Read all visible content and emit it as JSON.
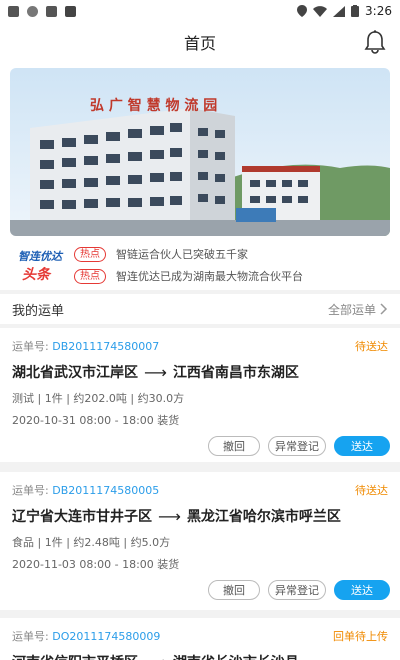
{
  "statusbar": {
    "time": "3:26"
  },
  "header": {
    "title": "首页"
  },
  "news": {
    "logo_line1": "智连优达",
    "logo_line2": "头条",
    "items": [
      {
        "tag": "热点",
        "text": "智链运合伙人已突破五千家"
      },
      {
        "tag": "热点",
        "text": "智连优达已成为湖南最大物流合伙平台"
      }
    ]
  },
  "banner": {
    "sign_text": "弘 广 智 慧 物 流 园"
  },
  "section": {
    "title": "我的运单",
    "all_label": "全部运单"
  },
  "orders": [
    {
      "no_label": "运单号:",
      "no": "DB2011174580007",
      "status": "待送达",
      "from": "湖北省武汉市江岸区",
      "to": "江西省南昌市东湖区",
      "info": "测试 | 1件 | 约202.0吨 | 约30.0方",
      "date": "2020-10-31 08:00 - 18:00 装货",
      "btn1": "撤回",
      "btn2": "异常登记",
      "btn3": "送达"
    },
    {
      "no_label": "运单号:",
      "no": "DB2011174580005",
      "status": "待送达",
      "from": "辽宁省大连市甘井子区",
      "to": "黑龙江省哈尔滨市呼兰区",
      "info": "食品 | 1件 | 约2.48吨 | 约5.0方",
      "date": "2020-11-03 08:00 - 18:00 装货",
      "btn1": "撤回",
      "btn2": "异常登记",
      "btn3": "送达"
    },
    {
      "no_label": "运单号:",
      "no": "DO2011174580009",
      "status": "回单待上传",
      "from": "河南省信阳市平桥区",
      "to": "湖南省长沙市长沙县"
    }
  ],
  "colors": {
    "accent": "#16a3f0",
    "status": "#f08a00",
    "hot": "#e53935"
  }
}
